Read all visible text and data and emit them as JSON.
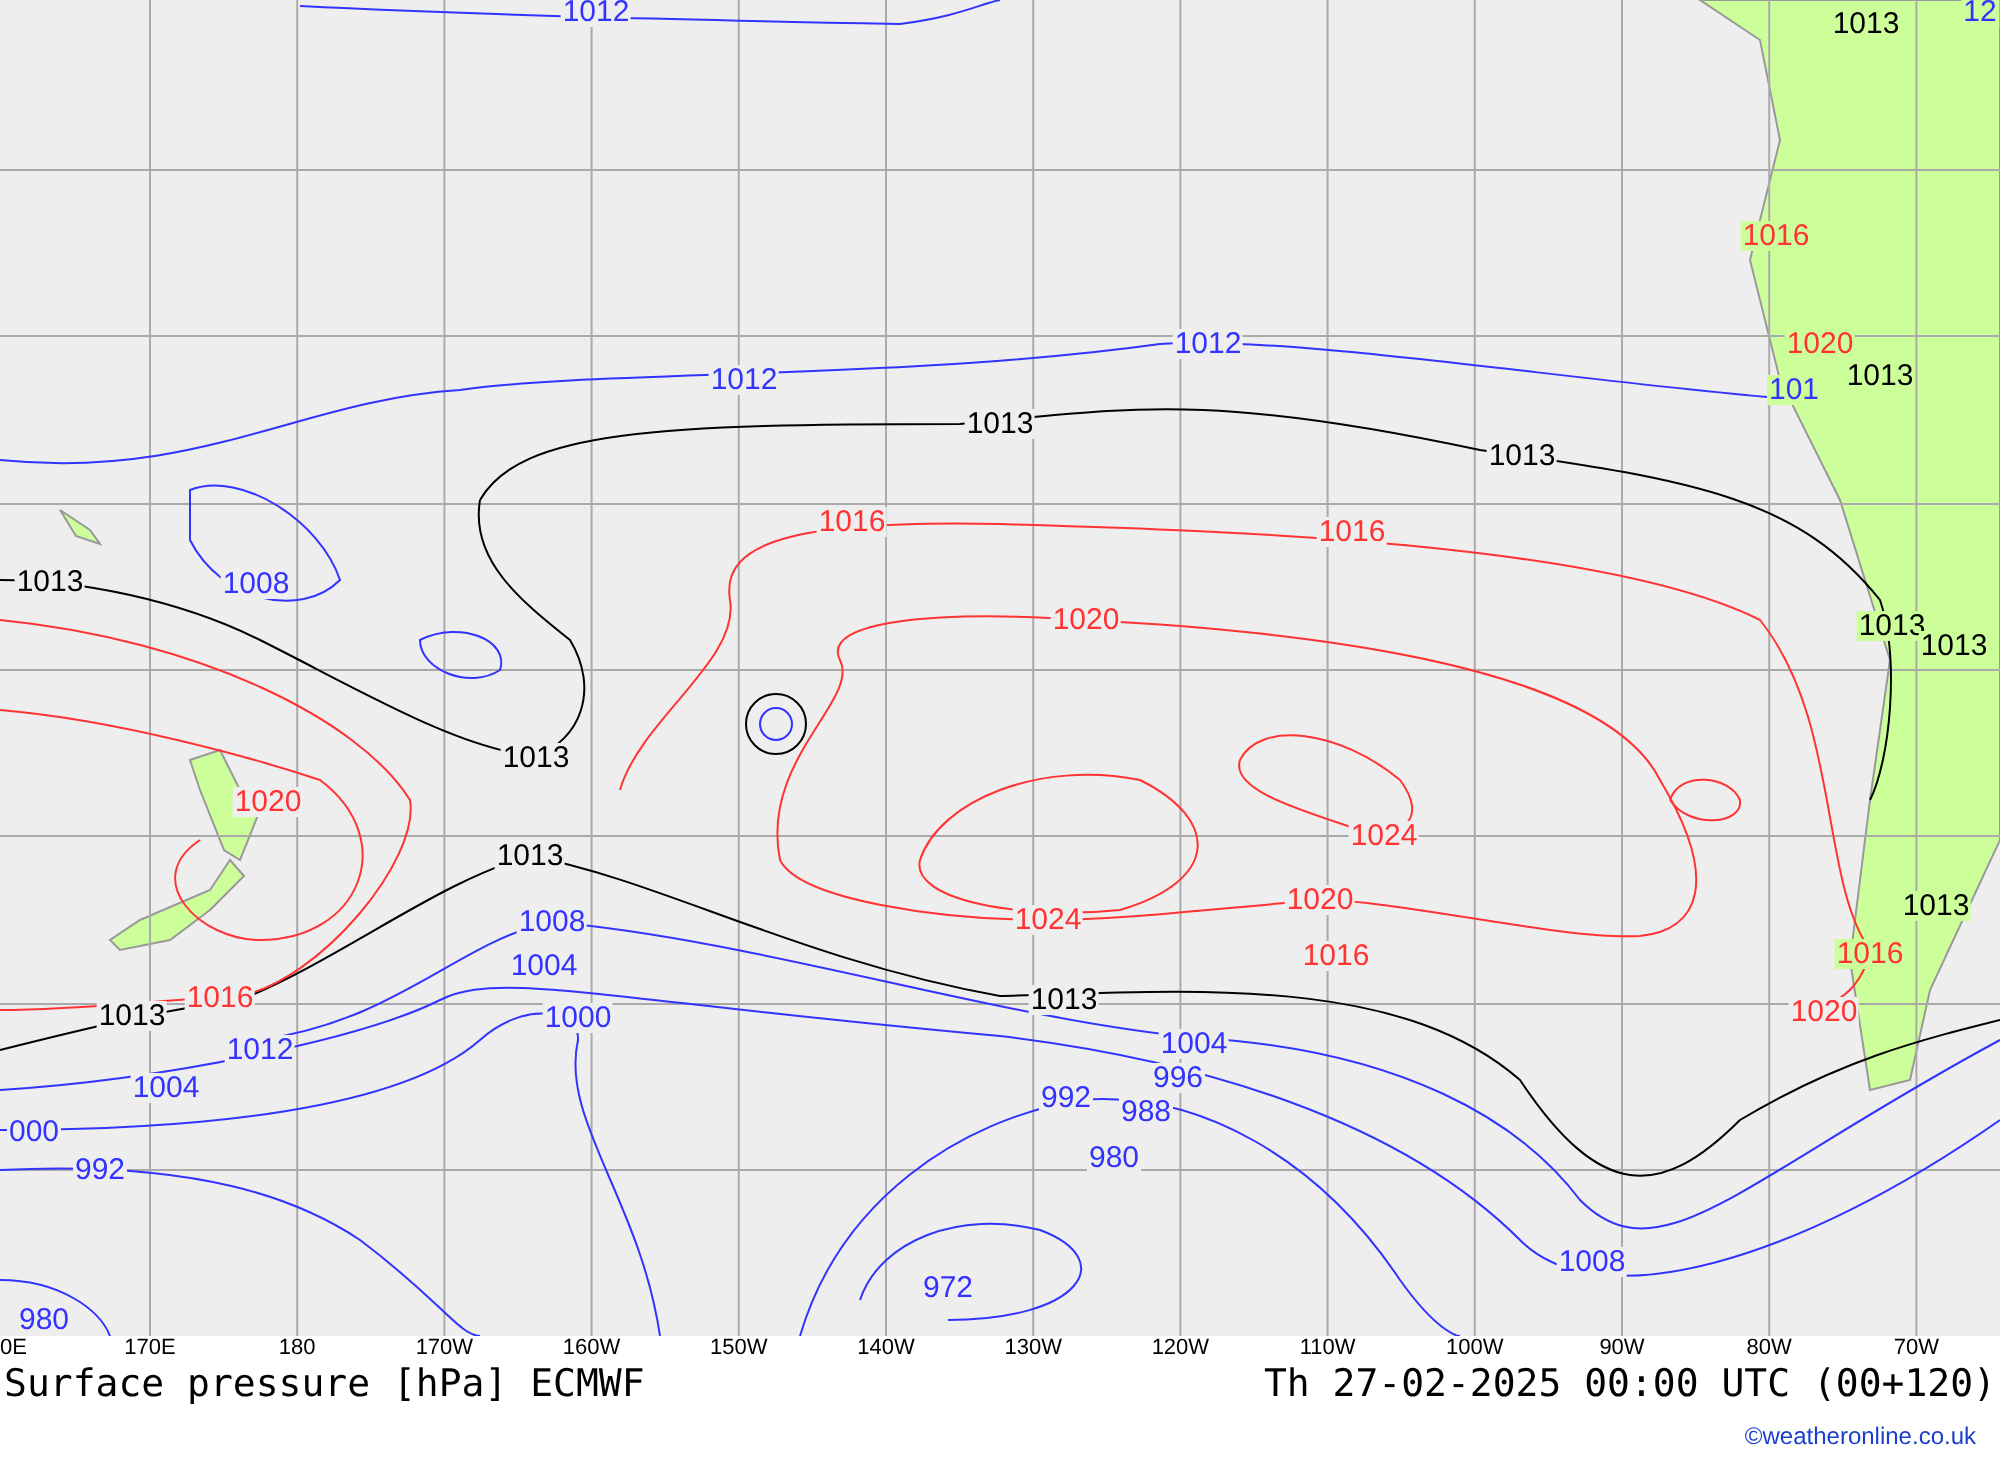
{
  "map": {
    "isobar_labels": [
      {
        "text": "1012",
        "color": "#3333ff"
      },
      {
        "text": "1013",
        "color": "#000000"
      },
      {
        "text": "12",
        "color": "#3333ff"
      },
      {
        "text": "1016",
        "color": "#ff3333"
      },
      {
        "text": "1012",
        "color": "#3333ff"
      },
      {
        "text": "1020",
        "color": "#ff3333"
      },
      {
        "text": "1012",
        "color": "#3333ff"
      },
      {
        "text": "101",
        "color": "#3333ff"
      },
      {
        "text": "1013",
        "color": "#000000"
      },
      {
        "text": "1013",
        "color": "#000000"
      },
      {
        "text": "1013",
        "color": "#000000"
      },
      {
        "text": "1016",
        "color": "#ff3333"
      },
      {
        "text": "1016",
        "color": "#ff3333"
      },
      {
        "text": "1013",
        "color": "#000000"
      },
      {
        "text": "1008",
        "color": "#3333ff"
      },
      {
        "text": "1020",
        "color": "#ff3333"
      },
      {
        "text": "1013",
        "color": "#000000"
      },
      {
        "text": "1013",
        "color": "#000000"
      },
      {
        "text": "1013",
        "color": "#000000"
      },
      {
        "text": "1020",
        "color": "#ff3333"
      },
      {
        "text": "1013",
        "color": "#000000"
      },
      {
        "text": "1024",
        "color": "#ff3333"
      },
      {
        "text": "1008",
        "color": "#3333ff"
      },
      {
        "text": "1024",
        "color": "#ff3333"
      },
      {
        "text": "1020",
        "color": "#ff3333"
      },
      {
        "text": "1013",
        "color": "#000000"
      },
      {
        "text": "1004",
        "color": "#3333ff"
      },
      {
        "text": "1016",
        "color": "#ff3333"
      },
      {
        "text": "1016",
        "color": "#ff3333"
      },
      {
        "text": "1013",
        "color": "#000000"
      },
      {
        "text": "1016",
        "color": "#ff3333"
      },
      {
        "text": "1000",
        "color": "#3333ff"
      },
      {
        "text": "1013",
        "color": "#000000"
      },
      {
        "text": "1020",
        "color": "#ff3333"
      },
      {
        "text": "1012",
        "color": "#3333ff"
      },
      {
        "text": "1004",
        "color": "#3333ff"
      },
      {
        "text": "1004",
        "color": "#3333ff"
      },
      {
        "text": "992",
        "color": "#3333ff"
      },
      {
        "text": "996",
        "color": "#3333ff"
      },
      {
        "text": "000",
        "color": "#3333ff"
      },
      {
        "text": "988",
        "color": "#3333ff"
      },
      {
        "text": "992",
        "color": "#3333ff"
      },
      {
        "text": "980",
        "color": "#3333ff"
      },
      {
        "text": "972",
        "color": "#3333ff"
      },
      {
        "text": "1008",
        "color": "#3333ff"
      },
      {
        "text": "980",
        "color": "#3333ff"
      }
    ]
  },
  "longitude_labels": [
    "0E",
    "170E",
    "180",
    "170W",
    "160W",
    "150W",
    "140W",
    "130W",
    "120W",
    "110W",
    "100W",
    "90W",
    "80W",
    "70W"
  ],
  "title": "Surface pressure [hPa] ECMWF",
  "valid_time": "Th 27-02-2025 00:00 UTC (00+120)",
  "credit": "©weatheronline.co.uk"
}
